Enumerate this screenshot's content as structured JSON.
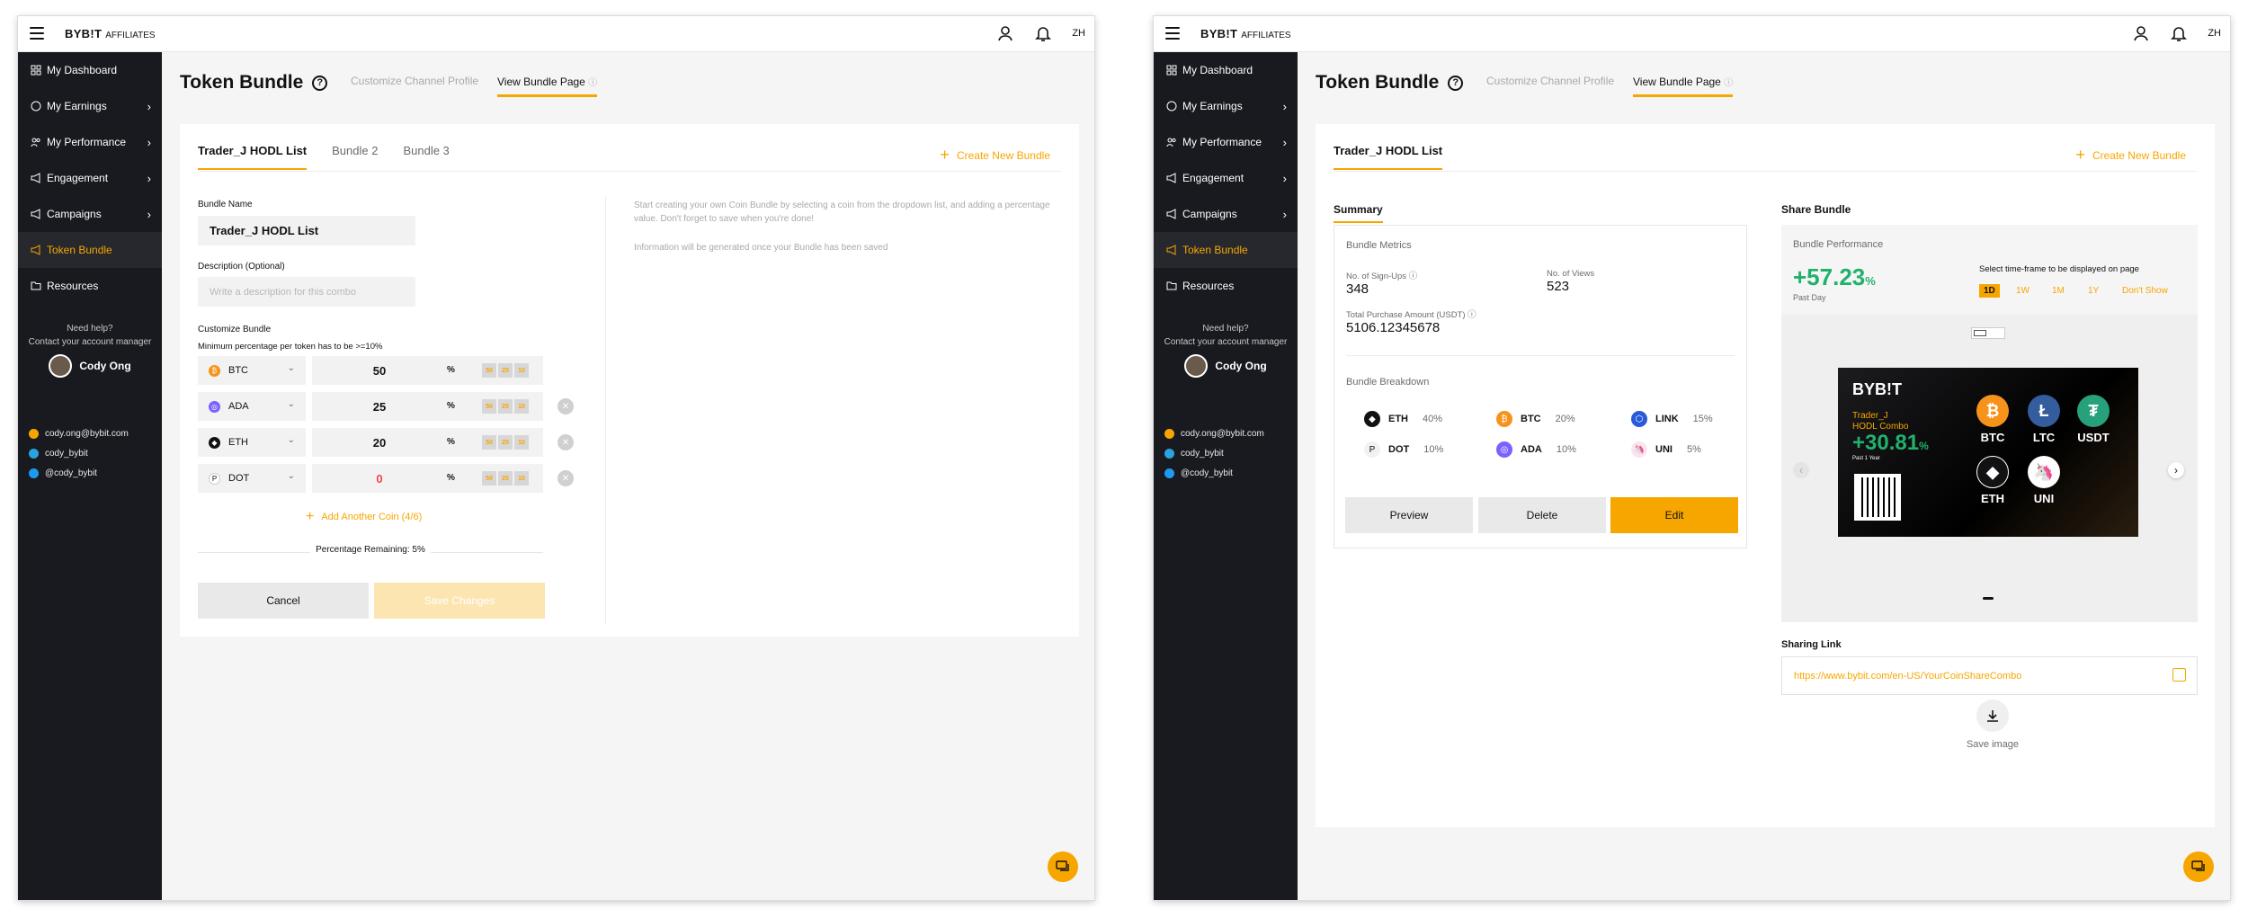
{
  "brand": {
    "logo": "BYB!T",
    "sub": "AFFILIATES",
    "lang": "ZH"
  },
  "sidebar": {
    "items": [
      {
        "label": "My Dashboard"
      },
      {
        "label": "My Earnings"
      },
      {
        "label": "My Performance"
      },
      {
        "label": "Engagement"
      },
      {
        "label": "Campaigns"
      },
      {
        "label": "Token Bundle"
      },
      {
        "label": "Resources"
      }
    ],
    "help_line1": "Need help?",
    "help_line2": "Contact your account manager",
    "manager": "Cody Ong",
    "email": "cody.ong@bybit.com",
    "telegram": "cody_bybit",
    "twitter": "@cody_bybit"
  },
  "page": {
    "title": "Token Bundle",
    "tab_customize": "Customize Channel Profile",
    "tab_view": "View Bundle Page",
    "create_new": "Create New Bundle"
  },
  "editor": {
    "tabs": [
      "Trader_J HODL List",
      "Bundle 2",
      "Bundle 3"
    ],
    "name_label": "Bundle Name",
    "name_value": "Trader_J HODL List",
    "desc_label": "Description (Optional)",
    "desc_placeholder": "Write a description for this combo",
    "customize_label": "Customize Bundle",
    "min_note": "Minimum percentage per token has to be >=10%",
    "rows": [
      {
        "coin": "BTC",
        "pct": "50"
      },
      {
        "coin": "ADA",
        "pct": "25"
      },
      {
        "coin": "ETH",
        "pct": "20"
      },
      {
        "coin": "DOT",
        "pct": "0"
      }
    ],
    "pct_sign": "%",
    "quick": [
      "50",
      "25",
      "10"
    ],
    "add_coin": "Add Another Coin (4/6)",
    "remaining": "Percentage Remaining: 5%",
    "cancel": "Cancel",
    "save": "Save Changes",
    "hint1": "Start creating your own Coin Bundle by selecting a coin from the dropdown list, and adding a percentage value. Don't forget to save when you're done!",
    "hint2": "Information will be generated once your Bundle has been saved"
  },
  "view": {
    "tab": "Trader_J HODL List",
    "summary": "Summary",
    "metrics_title": "Bundle Metrics",
    "signups_label": "No. of Sign-Ups",
    "signups": "348",
    "views_label": "No. of Views",
    "views": "523",
    "purchase_label": "Total Purchase Amount (USDT)",
    "purchase": "5106.12345678",
    "breakdown_title": "Bundle Breakdown",
    "breakdown": [
      {
        "coin": "ETH",
        "pct": "40%"
      },
      {
        "coin": "BTC",
        "pct": "20%"
      },
      {
        "coin": "LINK",
        "pct": "15%"
      },
      {
        "coin": "DOT",
        "pct": "10%"
      },
      {
        "coin": "ADA",
        "pct": "10%"
      },
      {
        "coin": "UNI",
        "pct": "5%"
      }
    ],
    "preview": "Preview",
    "delete": "Delete",
    "edit": "Edit",
    "share_title": "Share Bundle",
    "perf_title": "Bundle Performance",
    "perf_value": "+57.23",
    "perf_unit": "%",
    "perf_period": "Past Day",
    "tf_label": "Select time-frame to be displayed on page",
    "tf": [
      "1D",
      "1W",
      "1M",
      "1Y",
      "Don't Show"
    ],
    "banner": {
      "logo": "BYB!T",
      "name": "Trader_J",
      "combo": "HODL Combo",
      "pct": "+30.81",
      "unit": "%",
      "period": "Past 1 Year",
      "coins": [
        "BTC",
        "LTC",
        "USDT",
        "ETH",
        "UNI"
      ]
    },
    "link_label": "Sharing Link",
    "link": "https://www.bybit.com/en-US/YourCoinShareCombo",
    "save_image": "Save image"
  },
  "colors": {
    "accent": "#f7a600",
    "sidebar": "#181a20",
    "green": "#20b26c",
    "red": "#ef454a"
  }
}
